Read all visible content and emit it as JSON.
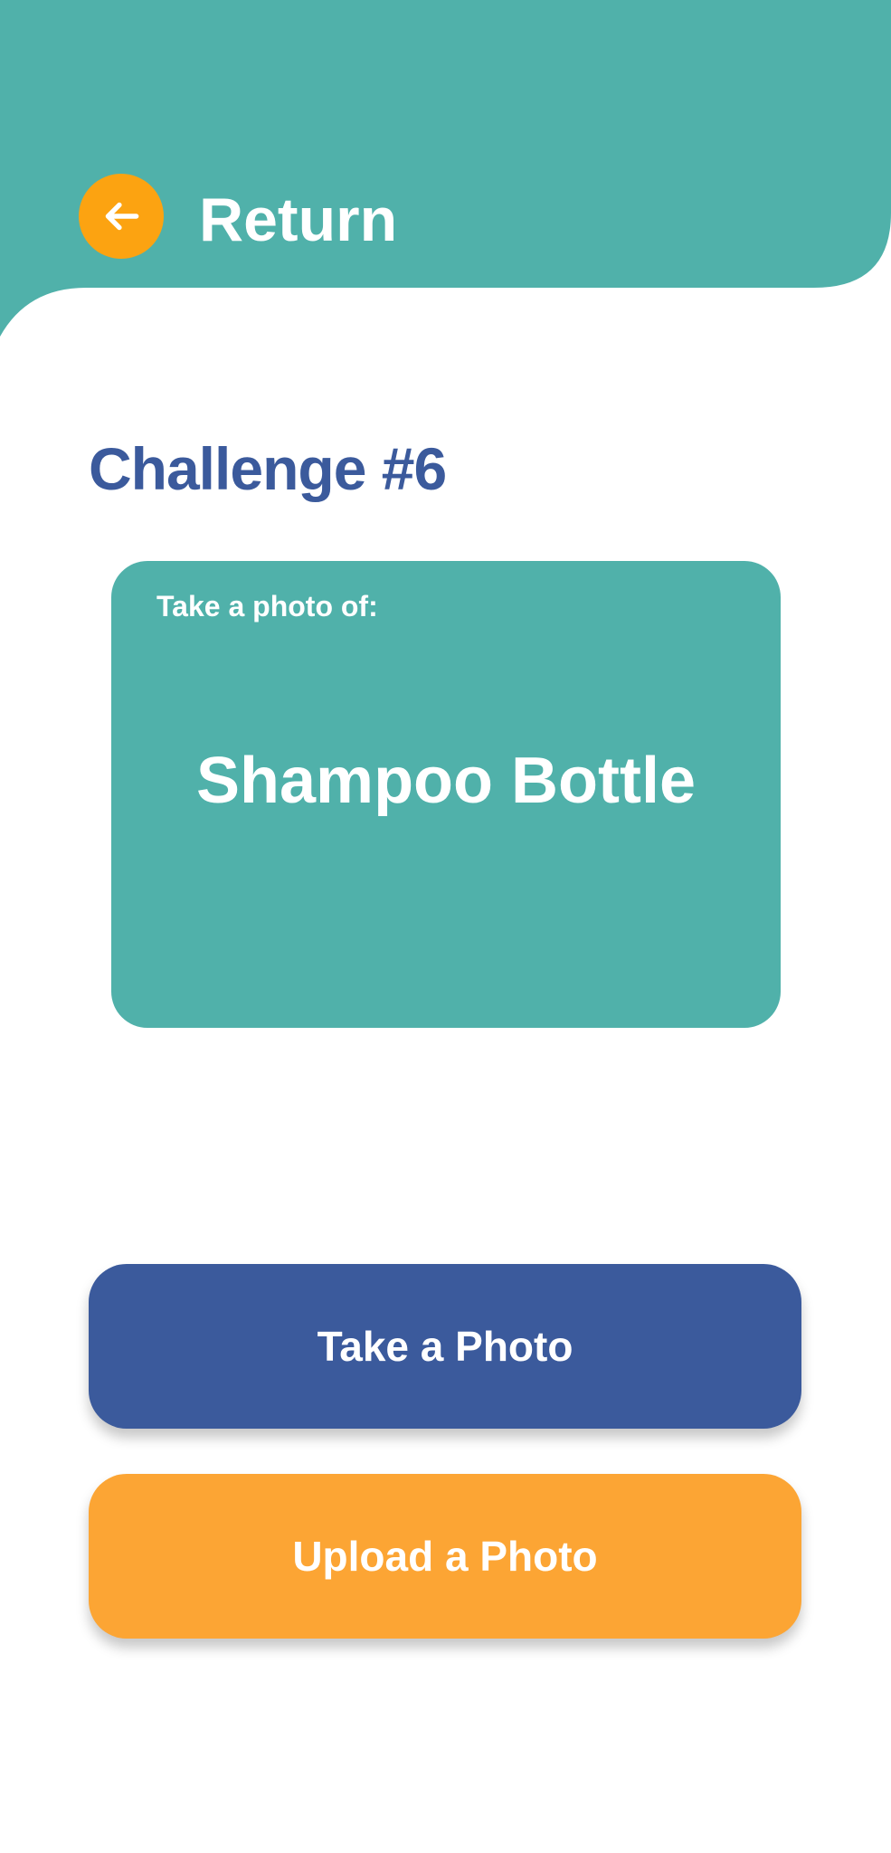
{
  "colors": {
    "header_bg": "#50b1aa",
    "back_button": "#fca311",
    "title_blue": "#3b5a9c",
    "card_teal": "#50b1aa",
    "take_photo_bg": "#3b5a9c",
    "upload_photo_bg": "#fca534"
  },
  "header": {
    "back_icon": "arrow-left-icon",
    "return_label": "Return"
  },
  "challenge": {
    "title": "Challenge #6",
    "prompt_intro": "Take a photo of:",
    "object": "Shampoo Bottle"
  },
  "actions": {
    "take_photo_label": "Take a Photo",
    "upload_photo_label": "Upload a Photo"
  }
}
